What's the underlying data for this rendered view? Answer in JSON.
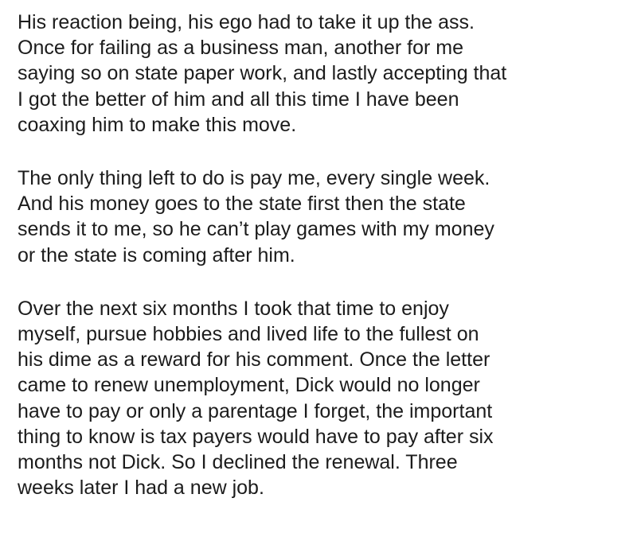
{
  "paragraphs": [
    {
      "lines": [
        "His reaction being, his ego had to take it up the ass.",
        "Once for failing as a business man, another for me",
        "saying so on state paper work, and lastly accepting that",
        "I got the better of him and all this time I have been",
        "coaxing him to make this move."
      ]
    },
    {
      "lines": [
        "The only thing left to do is pay me, every single week.",
        "And his money goes to the state first then the state",
        "sends it to me, so he can’t play games with my money",
        "or the state is coming after him."
      ]
    },
    {
      "lines": [
        "Over the next six months I took that time to enjoy",
        "myself, pursue hobbies and lived life to the fullest on",
        "his dime as a reward for his comment. Once the letter",
        "came to renew unemployment, Dick would no longer",
        "have to pay or only a parentage I forget, the important",
        "thing to know is tax payers would have to pay after six",
        "months not Dick. So I declined the renewal. Three",
        "weeks later I had a new job."
      ]
    }
  ]
}
